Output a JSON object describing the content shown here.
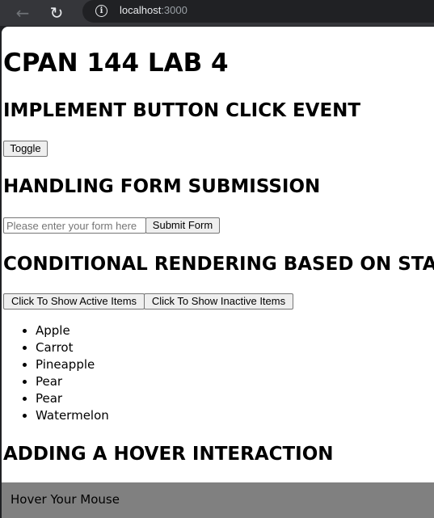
{
  "browser": {
    "url_host": "localhost",
    "url_port": ":3000"
  },
  "page": {
    "title": "CPAN 144 LAB 4",
    "section1": {
      "heading": "IMPLEMENT BUTTON CLICK EVENT",
      "toggle_label": "Toggle"
    },
    "section2": {
      "heading": "HANDLING FORM SUBMISSION",
      "input_placeholder": "Please enter your form here",
      "input_value": "",
      "submit_label": "Submit Form"
    },
    "section3": {
      "heading": "CONDITIONAL RENDERING BASED ON STATE",
      "active_label": "Click To Show Active Items",
      "inactive_label": "Click To Show Inactive Items",
      "items": [
        "Apple",
        "Carrot",
        "Pineapple",
        "Pear",
        "Pear",
        "Watermelon"
      ]
    },
    "section4": {
      "heading": "ADDING A HOVER INTERACTION",
      "hover_text": "Hover Your Mouse"
    }
  }
}
